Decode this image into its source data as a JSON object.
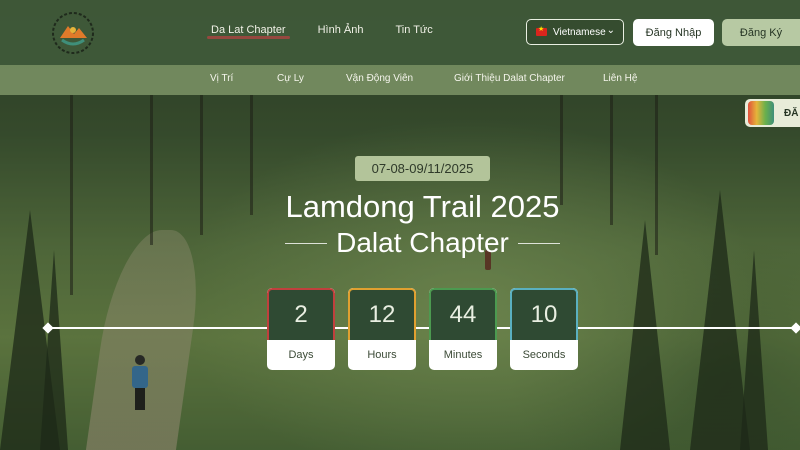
{
  "header": {
    "nav": [
      "Da Lat Chapter",
      "Hình Ảnh",
      "Tin Tức"
    ],
    "language": "Vietnamese",
    "login_label": "Đăng Nhập",
    "register_label": "Đăng Ký"
  },
  "subnav": [
    "Vị Trí",
    "Cự Ly",
    "Vận Động Viên",
    "Giới Thiệu Dalat Chapter",
    "Liên Hệ"
  ],
  "side_badge": {
    "label": "ĐĂ"
  },
  "hero": {
    "date": "07-08-09/11/2025",
    "title_line1": "Lamdong Trail 2025",
    "title_line2": "Dalat Chapter"
  },
  "countdown": [
    {
      "value": "2",
      "label": "Days",
      "color": "#c0403d"
    },
    {
      "value": "12",
      "label": "Hours",
      "color": "#e0a030"
    },
    {
      "value": "44",
      "label": "Minutes",
      "color": "#4c9a50"
    },
    {
      "value": "10",
      "label": "Seconds",
      "color": "#5ab0c0"
    }
  ],
  "colors": {
    "header_bg": "#405a3a",
    "subnav_bg": "#7a9264",
    "accent_button": "#b7c9a3",
    "countdown_bg": "#2f4a33"
  }
}
